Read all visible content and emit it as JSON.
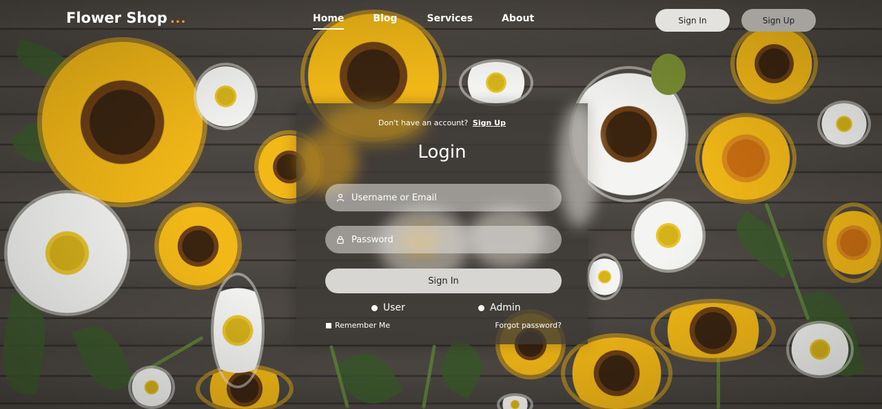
{
  "header": {
    "logo_text": "Flower Shop",
    "logo_dots": "...",
    "nav": {
      "home": "Home",
      "blog": "Blog",
      "services": "Services",
      "about": "About"
    },
    "sign_in": "Sign In",
    "sign_up": "Sign Up"
  },
  "login": {
    "no_account_text": "Don't have an account?",
    "no_account_link": "Sign Up",
    "title": "Login",
    "username_placeholder": "Username or Email",
    "password_placeholder": "Password",
    "submit": "Sign In",
    "role_user": "User",
    "role_admin": "Admin",
    "remember": "Remember Me",
    "forgot": "Forgot password?"
  },
  "icons": {
    "user": "user-icon",
    "lock": "lock-icon"
  },
  "colors": {
    "accent_dots": "#f0a020",
    "sign_in_bg": "#e4e2df",
    "sign_up_bg": "#a6a39f",
    "card_bg": "rgba(62,58,54,0.78)"
  }
}
